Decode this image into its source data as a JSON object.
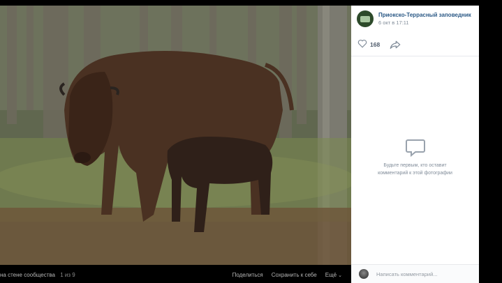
{
  "post": {
    "author": "Приокско-Террасный заповедник",
    "date": "6 окт в 17:11",
    "likes": "168"
  },
  "comments": {
    "empty_line1": "Будьте первым, кто оставит",
    "empty_line2": "комментарий к этой фотографии",
    "placeholder": "Написать комментарий..."
  },
  "viewer": {
    "album_label": "на стене сообщества",
    "counter": "1 из 9",
    "share_label": "Поделиться",
    "save_label": "Сохранить к себе",
    "more_label": "Ещё"
  },
  "icons": {
    "like": "heart-icon",
    "share": "share-arrow-icon",
    "comments": "speech-bubble-icon",
    "more": "chevron-down-icon"
  }
}
